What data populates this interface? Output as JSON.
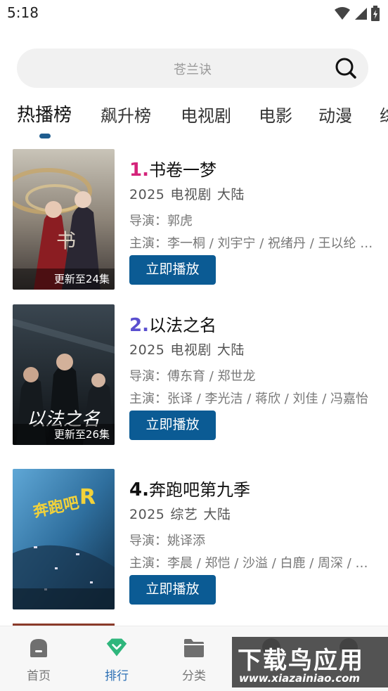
{
  "status_bar": {
    "time": "5:18"
  },
  "search": {
    "placeholder": "苍兰诀"
  },
  "tabs": [
    {
      "label": "热播榜",
      "active": true
    },
    {
      "label": "飙升榜"
    },
    {
      "label": "电视剧"
    },
    {
      "label": "电影"
    },
    {
      "label": "动漫"
    },
    {
      "label": "综"
    }
  ],
  "items": [
    {
      "rank": "1.",
      "rank_color": "#d4237a",
      "title": "书卷一梦",
      "year": "2025",
      "type": "电视剧",
      "region": "大陆",
      "director": "导演：郭虎",
      "cast": "主演：李一桐 / 刘宇宁 / 祝绪丹 / 王以纶 / 范世錡",
      "badge": "更新至24集",
      "play": "立即播放"
    },
    {
      "rank": "2.",
      "rank_color": "#5a4fcf",
      "title": "以法之名",
      "year": "2025",
      "type": "电视剧",
      "region": "大陆",
      "director": "导演：傅东育 / 郑世龙",
      "cast": "主演：张译 / 李光洁 / 蒋欣 / 刘佳 / 冯嘉怡",
      "badge": "更新至26集",
      "play": "立即播放"
    },
    {
      "rank": "4.",
      "rank_color": "#111111",
      "title": "奔跑吧第九季",
      "year": "2025",
      "type": "综艺",
      "region": "大陆",
      "director": "导演：姚译添",
      "cast": "主演：李晨 / 郑恺 / 沙溢 / 白鹿 / 周深 / 范丞丞",
      "badge": "",
      "play": "立即播放"
    }
  ],
  "bottom_nav": [
    {
      "label": "首页"
    },
    {
      "label": "排行",
      "active": true
    },
    {
      "label": "分类"
    },
    {
      "label": ""
    },
    {
      "label": ""
    }
  ],
  "watermark": {
    "main": "下载鸟应用",
    "sub": "www.xiazainiao.com"
  },
  "colors": {
    "accent": "#0b5b94",
    "nav_active": "#2b6fb4",
    "nav_active_icon": "#2fb67c"
  }
}
